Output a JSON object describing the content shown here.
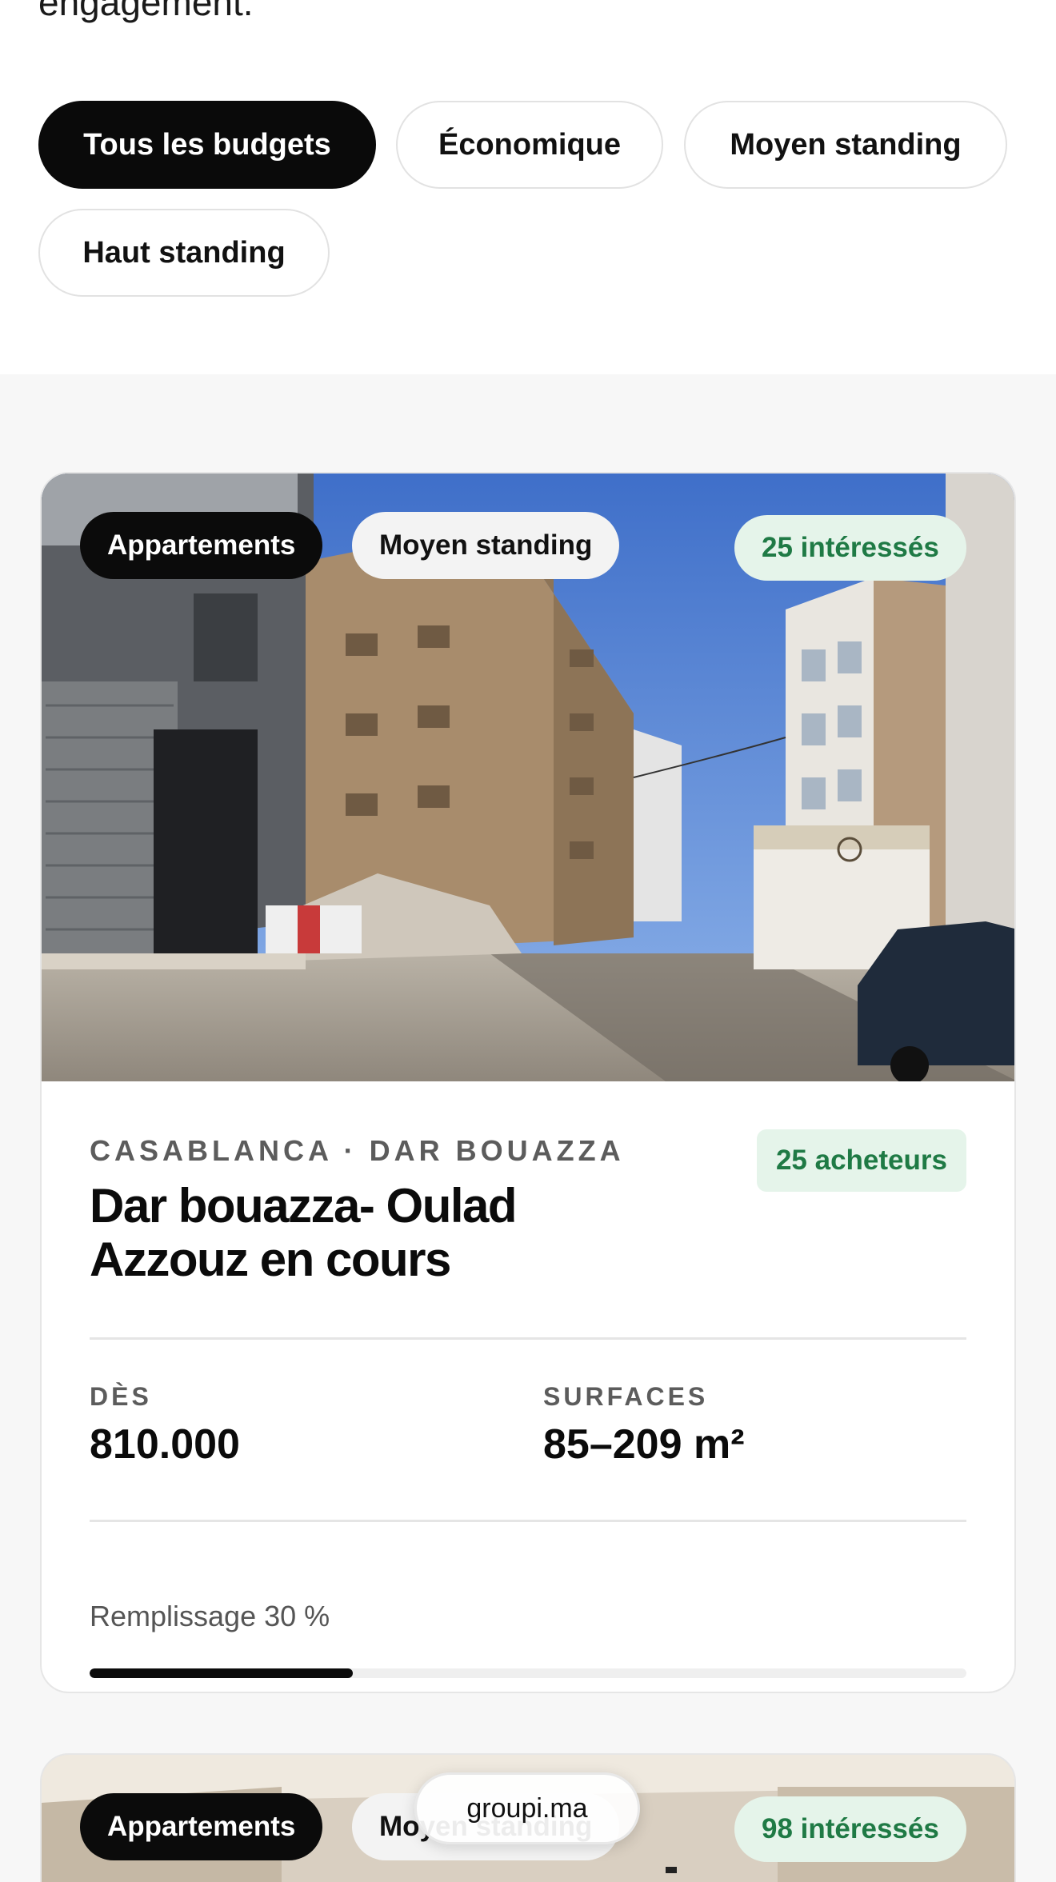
{
  "intro": {
    "text": "engagement."
  },
  "filters": [
    {
      "label": "Tous les budgets",
      "active": true
    },
    {
      "label": "Économique",
      "active": false
    },
    {
      "label": "Moyen standing",
      "active": false
    },
    {
      "label": "Haut standing",
      "active": false
    }
  ],
  "listings": [
    {
      "category": "Appartements",
      "standing": "Moyen standing",
      "interested": "25 intéressés",
      "location": "CASABLANCA · DAR BOUAZZA",
      "buyers": "25 acheteurs",
      "title": "Dar bouazza- Oulad Azzouz en cours",
      "price_label": "DÈS",
      "price_value": "810.000",
      "surface_label": "SURFACES",
      "surface_value": "85–209 m²",
      "fill_label": "Remplissage 30 %",
      "fill_fraction": 0.3
    },
    {
      "category": "Appartements",
      "standing": "Moyen standing",
      "interested": "98 intéressés"
    }
  ],
  "overlay": {
    "domain": "groupi.ma"
  },
  "colors": {
    "accent_green": "#1f7a45",
    "green_bg": "#e5f4ea",
    "dark": "#0b0b0b"
  }
}
